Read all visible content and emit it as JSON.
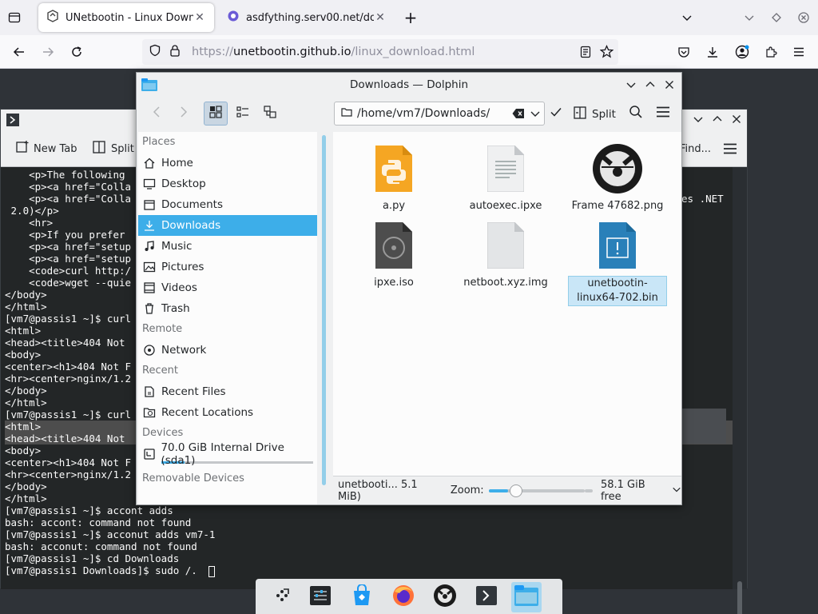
{
  "firefox": {
    "tabs": [
      {
        "label": "UNetbootin - Linux Downl",
        "active": true
      },
      {
        "label": "asdfything.serv00.net/dow",
        "active": false
      }
    ],
    "url": {
      "scheme": "https://",
      "host": "unetbootin.github.io",
      "path": "/linux_download.html"
    }
  },
  "konsole": {
    "toolbar": {
      "new_tab": "New Tab",
      "split": "Split",
      "find": "Find..."
    },
    "lines": [
      "    <p>The following",
      "    <p><a href=\"Colla",
      "    <p><a href=\"Colla",
      " 2.0)</p>",
      "    <hr>",
      "    <p>If you prefer",
      "    <p><a href=\"setup",
      "    <p><a href=\"setup",
      "    <code>curl http:/",
      "    <code>wget --quie",
      "</body>",
      "</html>",
      "[vm7@passis1 ~]$ curl",
      "<html>",
      "<head><title>404 Not",
      "<body>",
      "<center><h1>404 Not F",
      "<hr><center>nginx/1.2",
      "</body>",
      "</html>",
      "[vm7@passis1 ~]$ curl",
      "<html>",
      "<head><title>404 Not",
      "<body>",
      "<center><h1>404 Not F",
      "<hr><center>nginx/1.2",
      "</body>",
      "</html>",
      "[vm7@passis1 ~]$ accont adds",
      "bash: accont: command not found",
      "[vm7@passis1 ~]$ acconut adds vm7-1",
      "bash: acconut: command not found",
      "[vm7@passis1 ~]$ cd Downloads",
      "[vm7@passis1 Downloads]$ sudo /."
    ],
    "right_fragment": "es .NET"
  },
  "dolphin": {
    "title": "Downloads — Dolphin",
    "path": "/home/vm7/Downloads/",
    "split_label": "Split",
    "sidebar": {
      "places_header": "Places",
      "places": [
        {
          "label": "Home",
          "icon": "home-icon"
        },
        {
          "label": "Desktop",
          "icon": "desktop-icon"
        },
        {
          "label": "Documents",
          "icon": "documents-icon"
        },
        {
          "label": "Downloads",
          "icon": "downloads-icon",
          "selected": true
        },
        {
          "label": "Music",
          "icon": "music-icon"
        },
        {
          "label": "Pictures",
          "icon": "pictures-icon"
        },
        {
          "label": "Videos",
          "icon": "videos-icon"
        },
        {
          "label": "Trash",
          "icon": "trash-icon"
        }
      ],
      "remote_header": "Remote",
      "remote": [
        {
          "label": "Network",
          "icon": "network-icon"
        }
      ],
      "recent_header": "Recent",
      "recent": [
        {
          "label": "Recent Files",
          "icon": "recent-files-icon"
        },
        {
          "label": "Recent Locations",
          "icon": "recent-locations-icon"
        }
      ],
      "devices_header": "Devices",
      "devices": [
        {
          "label": "70.0 GiB Internal Drive (sda1)",
          "icon": "drive-icon",
          "usage": 0.15
        }
      ],
      "removable_header": "Removable Devices"
    },
    "files": [
      {
        "name": "a.py",
        "icon": "python-file-icon"
      },
      {
        "name": "autoexec.ipxe",
        "icon": "text-file-icon"
      },
      {
        "name": "Frame 47682.png",
        "icon": "image-file-icon"
      },
      {
        "name": "ipxe.iso",
        "icon": "disc-image-icon"
      },
      {
        "name": "netboot.xyz.img",
        "icon": "generic-file-icon"
      },
      {
        "name": "unetbootin-linux64-702.bin",
        "icon": "binary-file-icon",
        "selected": true
      }
    ],
    "status": {
      "selection": "unetbooti... 5.1 MiB)",
      "zoom_label": "Zoom:",
      "zoom_level": 0.2,
      "free": "58.1 GiB free"
    }
  },
  "taskbar": {
    "apps": [
      "app-launcher",
      "system-settings",
      "discover",
      "firefox",
      "image-app",
      "konsole",
      "dolphin"
    ]
  }
}
